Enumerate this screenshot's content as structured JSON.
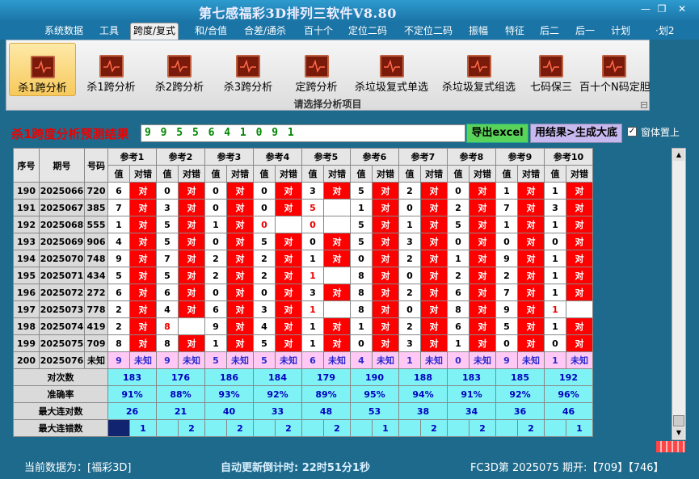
{
  "window": {
    "title": "第七感福彩3D排列三软件V8.80",
    "min_label": "—",
    "max_label": "❐",
    "close_label": "✕"
  },
  "menu": [
    "系统数据",
    "工具",
    "跨度/复式",
    "和/合值",
    "合差/通杀",
    "百十个",
    "定位二码",
    "不定位二码",
    "振幅",
    "特征",
    "后二",
    "后一",
    "计划",
    "·划2"
  ],
  "ribbon": {
    "buttons": [
      "杀1跨分析",
      "杀1跨分析",
      "杀2跨分析",
      "杀3跨分析",
      "定跨分析",
      "杀垃圾复式单选",
      "杀垃圾复式组选",
      "七码保三",
      "百十个N码定胆"
    ],
    "caption": "请选择分析项目",
    "corner": "⌐"
  },
  "result": {
    "label": "杀1跨度分析预测结果",
    "value": "9 9 5 5 6 4 1 0 9 1",
    "excel_button": "导出excel",
    "gen_button": "用结果>生成大底",
    "checkbox_mark": "✓",
    "checkbox_label": "窗体置上"
  },
  "table": {
    "headers": {
      "seq": "序号",
      "period": "期号",
      "code": "号码",
      "ref_sub": [
        "值",
        "对错"
      ]
    },
    "refs": [
      "参考1",
      "参考2",
      "参考3",
      "参考4",
      "参考5",
      "参考6",
      "参考7",
      "参考8",
      "参考9",
      "参考10"
    ],
    "rows": [
      {
        "seq": "190",
        "period": "2025066",
        "code": "720",
        "cells": [
          [
            "6",
            "对"
          ],
          [
            "0",
            "对"
          ],
          [
            "0",
            "对"
          ],
          [
            "0",
            "对"
          ],
          [
            "3",
            "对"
          ],
          [
            "5",
            "对"
          ],
          [
            "2",
            "对"
          ],
          [
            "0",
            "对"
          ],
          [
            "1",
            "对"
          ],
          [
            "1",
            "对"
          ]
        ]
      },
      {
        "seq": "191",
        "period": "2025067",
        "code": "385",
        "cells": [
          [
            "7",
            "对"
          ],
          [
            "3",
            "对"
          ],
          [
            "0",
            "对"
          ],
          [
            "0",
            "对"
          ],
          [
            "5",
            ""
          ],
          [
            "1",
            "对"
          ],
          [
            "0",
            "对"
          ],
          [
            "2",
            "对"
          ],
          [
            "7",
            "对"
          ],
          [
            "3",
            "对"
          ]
        ]
      },
      {
        "seq": "192",
        "period": "2025068",
        "code": "555",
        "cells": [
          [
            "1",
            "对"
          ],
          [
            "5",
            "对"
          ],
          [
            "1",
            "对"
          ],
          [
            "0",
            ""
          ],
          [
            "0",
            ""
          ],
          [
            "5",
            "对"
          ],
          [
            "1",
            "对"
          ],
          [
            "5",
            "对"
          ],
          [
            "1",
            "对"
          ],
          [
            "1",
            "对"
          ]
        ]
      },
      {
        "seq": "193",
        "period": "2025069",
        "code": "906",
        "cells": [
          [
            "4",
            "对"
          ],
          [
            "5",
            "对"
          ],
          [
            "0",
            "对"
          ],
          [
            "5",
            "对"
          ],
          [
            "0",
            "对"
          ],
          [
            "5",
            "对"
          ],
          [
            "3",
            "对"
          ],
          [
            "0",
            "对"
          ],
          [
            "0",
            "对"
          ],
          [
            "0",
            "对"
          ]
        ]
      },
      {
        "seq": "194",
        "period": "2025070",
        "code": "748",
        "cells": [
          [
            "9",
            "对"
          ],
          [
            "7",
            "对"
          ],
          [
            "2",
            "对"
          ],
          [
            "2",
            "对"
          ],
          [
            "1",
            "对"
          ],
          [
            "0",
            "对"
          ],
          [
            "2",
            "对"
          ],
          [
            "1",
            "对"
          ],
          [
            "9",
            "对"
          ],
          [
            "1",
            "对"
          ]
        ]
      },
      {
        "seq": "195",
        "period": "2025071",
        "code": "434",
        "cells": [
          [
            "5",
            "对"
          ],
          [
            "5",
            "对"
          ],
          [
            "2",
            "对"
          ],
          [
            "2",
            "对"
          ],
          [
            "1",
            ""
          ],
          [
            "8",
            "对"
          ],
          [
            "0",
            "对"
          ],
          [
            "2",
            "对"
          ],
          [
            "2",
            "对"
          ],
          [
            "1",
            "对"
          ]
        ]
      },
      {
        "seq": "196",
        "period": "2025072",
        "code": "272",
        "cells": [
          [
            "6",
            "对"
          ],
          [
            "6",
            "对"
          ],
          [
            "0",
            "对"
          ],
          [
            "0",
            "对"
          ],
          [
            "3",
            "对"
          ],
          [
            "8",
            "对"
          ],
          [
            "2",
            "对"
          ],
          [
            "6",
            "对"
          ],
          [
            "7",
            "对"
          ],
          [
            "1",
            "对"
          ]
        ]
      },
      {
        "seq": "197",
        "period": "2025073",
        "code": "778",
        "cells": [
          [
            "2",
            "对"
          ],
          [
            "4",
            "对"
          ],
          [
            "6",
            "对"
          ],
          [
            "3",
            "对"
          ],
          [
            "1",
            ""
          ],
          [
            "8",
            "对"
          ],
          [
            "0",
            "对"
          ],
          [
            "8",
            "对"
          ],
          [
            "9",
            "对"
          ],
          [
            "1",
            ""
          ]
        ]
      },
      {
        "seq": "198",
        "period": "2025074",
        "code": "419",
        "cells": [
          [
            "2",
            "对"
          ],
          [
            "8",
            ""
          ],
          [
            "9",
            "对"
          ],
          [
            "4",
            "对"
          ],
          [
            "1",
            "对"
          ],
          [
            "1",
            "对"
          ],
          [
            "2",
            "对"
          ],
          [
            "6",
            "对"
          ],
          [
            "5",
            "对"
          ],
          [
            "1",
            "对"
          ]
        ]
      },
      {
        "seq": "199",
        "period": "2025075",
        "code": "709",
        "cells": [
          [
            "8",
            "对"
          ],
          [
            "8",
            "对"
          ],
          [
            "1",
            "对"
          ],
          [
            "5",
            "对"
          ],
          [
            "1",
            "对"
          ],
          [
            "0",
            "对"
          ],
          [
            "3",
            "对"
          ],
          [
            "1",
            "对"
          ],
          [
            "0",
            "对"
          ],
          [
            "0",
            "对"
          ]
        ]
      }
    ],
    "unknown_row": {
      "seq": "200",
      "period": "2025076",
      "code": "未知",
      "values": [
        "9",
        "9",
        "5",
        "5",
        "6",
        "4",
        "1",
        "0",
        "9",
        "1"
      ],
      "status": "未知"
    },
    "stats": [
      {
        "label": "对次数",
        "values": [
          "183",
          "176",
          "186",
          "184",
          "179",
          "190",
          "188",
          "183",
          "185",
          "192"
        ]
      },
      {
        "label": "准确率",
        "values": [
          "91%",
          "88%",
          "93%",
          "92%",
          "89%",
          "95%",
          "94%",
          "91%",
          "92%",
          "96%"
        ]
      },
      {
        "label": "最大连对数",
        "values": [
          "26",
          "21",
          "40",
          "33",
          "48",
          "53",
          "38",
          "34",
          "36",
          "46"
        ]
      },
      {
        "label": "最大连错数",
        "values": [
          "1",
          "2",
          "2",
          "2",
          "2",
          "1",
          "2",
          "2",
          "2",
          "1"
        ]
      }
    ]
  },
  "scroll": {
    "up": "▲",
    "down": "▼"
  },
  "status": {
    "left": "当前数据为：[福彩3D]",
    "countdown": "自动更新倒计时:  22时51分1秒",
    "right": "FC3D第 2025075 期开:【709】【746】"
  },
  "colors": {
    "hit": "#ff0000",
    "miss": "#ffffff",
    "unknown": "#ffc8f5",
    "stats": "#7ef2f5",
    "bg": "#1d6a8c"
  }
}
